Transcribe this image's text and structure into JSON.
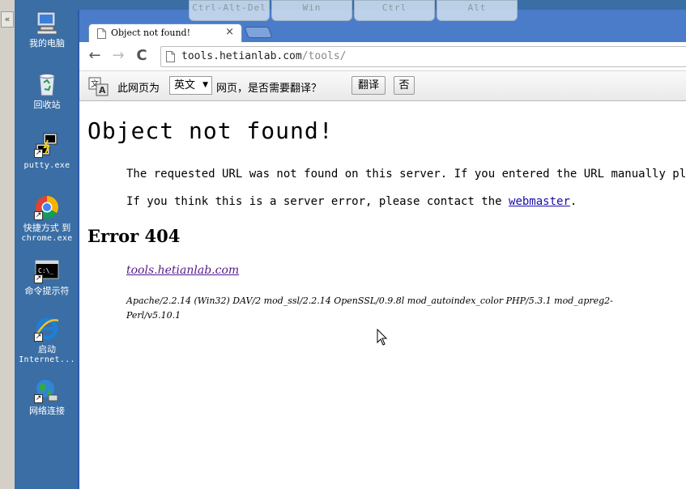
{
  "rdp_toolbar": {
    "buttons": [
      "Ctrl-Alt-Del",
      "Win",
      "Ctrl",
      "Alt"
    ]
  },
  "sidebar_handle": {
    "glyph": "«"
  },
  "desktop": {
    "icons": [
      {
        "label": "我的电脑",
        "icon": "my-computer-icon"
      },
      {
        "label": "回收站",
        "icon": "recycle-bin-icon"
      },
      {
        "label": "putty.exe",
        "icon": "putty-icon"
      },
      {
        "label_line1": "快捷方式 到",
        "label_line2": "chrome.exe",
        "icon": "chrome-icon"
      },
      {
        "label": "命令提示符",
        "icon": "command-prompt-icon"
      },
      {
        "label_line1": "启动",
        "label_line2": "Internet...",
        "icon": "internet-explorer-icon"
      },
      {
        "label": "网络连接",
        "icon": "network-connections-icon"
      }
    ]
  },
  "browser": {
    "tab": {
      "title": "Object not found!",
      "close": "×"
    },
    "toolbar": {
      "back": "←",
      "forward": "→",
      "reload": "C",
      "url_host": "tools.hetianlab.com",
      "url_path": "/tools/"
    },
    "translate_bar": {
      "prefix": "此网页为",
      "language": "英文",
      "suffix": "网页，是否需要翻译？",
      "translate_button": "翻译",
      "no_button": "否"
    }
  },
  "page": {
    "heading": "Object not found!",
    "para1": "The requested URL was not found on this server. If you entered the URL manually please",
    "para2_prefix": "If you think this is a server error, please contact the ",
    "para2_link": "webmaster",
    "para2_suffix": ".",
    "error_heading": "Error 404",
    "address_link": "tools.hetianlab.com",
    "server_line1": "Apache/2.2.14 (Win32) DAV/2 mod_ssl/2.2.14 OpenSSL/0.9.8l mod_autoindex_color PHP/5.3.1 mod_apreg2-",
    "server_line2": "Perl/v5.10.1"
  },
  "colors": {
    "desktop": "#3a6ea5",
    "browser_frame": "#4a7cc9",
    "link": "#1a0dab",
    "visited_link": "#551a8b"
  }
}
